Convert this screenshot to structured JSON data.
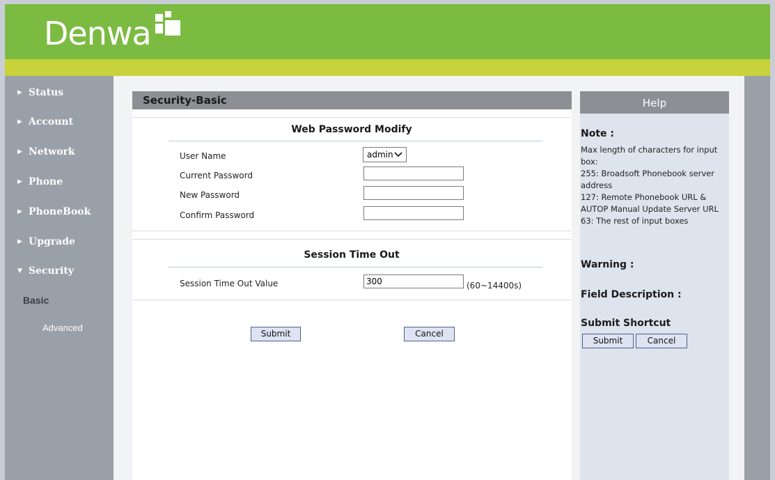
{
  "brand": {
    "name": "Denwa"
  },
  "sidebar": {
    "items": [
      {
        "label": "Status"
      },
      {
        "label": "Account"
      },
      {
        "label": "Network"
      },
      {
        "label": "Phone"
      },
      {
        "label": "PhoneBook"
      },
      {
        "label": "Upgrade"
      },
      {
        "label": "Security"
      }
    ],
    "security_subitems": [
      {
        "label": "Basic",
        "active": true
      },
      {
        "label": "Advanced",
        "active": false
      }
    ]
  },
  "main": {
    "title": "Security-Basic",
    "password_section": {
      "title": "Web Password Modify",
      "user_name_label": "User Name",
      "user_name_value": "admin",
      "current_password_label": "Current Password",
      "current_password_value": "",
      "new_password_label": "New Password",
      "new_password_value": "",
      "confirm_password_label": "Confirm Password",
      "confirm_password_value": ""
    },
    "session_section": {
      "title": "Session Time Out",
      "value_label": "Session Time Out Value",
      "value": "300",
      "range_hint": "(60~14400s)"
    },
    "submit_label": "Submit",
    "cancel_label": "Cancel"
  },
  "help": {
    "title": "Help",
    "note_heading": "Note :",
    "note_lines": [
      "Max length of characters for input box:",
      "255: Broadsoft Phonebook server address",
      "127: Remote Phonebook URL & AUTOP Manual Update Server URL",
      "63: The rest of input boxes"
    ],
    "warning_heading": "Warning :",
    "field_description_heading": "Field Description :",
    "submit_shortcut_heading": "Submit Shortcut",
    "submit_label": "Submit",
    "cancel_label": "Cancel"
  },
  "colors": {
    "header_green": "#7cbb42",
    "header_strip": "#c8d23a",
    "sidebar_gray": "#9aa0a8",
    "panel_title_gray": "#8c8f94",
    "help_bg": "#dde4ed"
  }
}
